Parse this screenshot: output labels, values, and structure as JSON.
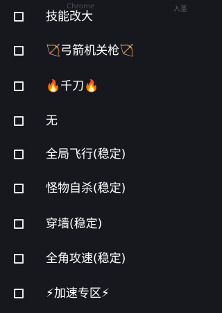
{
  "header": {
    "ghost_title": "Chrome",
    "top_right_text": "入圣"
  },
  "menu": {
    "items": [
      {
        "label": "技能改大"
      },
      {
        "label": "🏹弓箭机关枪🏹"
      },
      {
        "label": "🔥千刀🔥"
      },
      {
        "label": "无"
      },
      {
        "label": "全局飞行(稳定)"
      },
      {
        "label": "怪物自杀(稳定)"
      },
      {
        "label": "穿墙(稳定)"
      },
      {
        "label": "全角攻速(稳定)"
      },
      {
        "label": "⚡加速专区⚡"
      }
    ]
  }
}
